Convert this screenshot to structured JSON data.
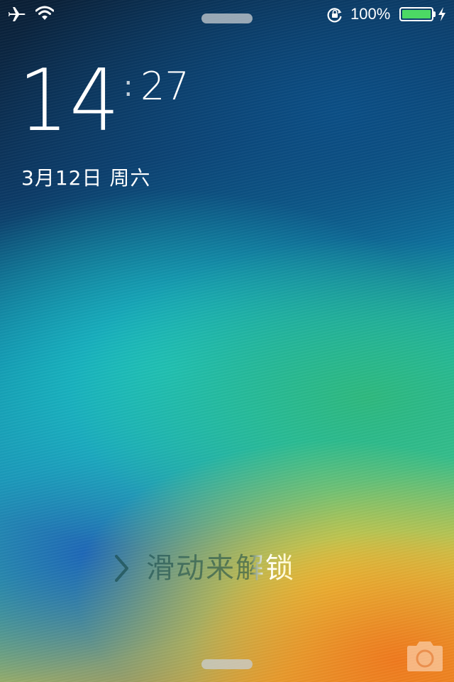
{
  "status_bar": {
    "battery_percent": "100%",
    "battery_level": 1.0,
    "icons": [
      "airplane-icon",
      "wifi-icon",
      "rotation-lock-icon",
      "battery-icon",
      "charging-icon"
    ],
    "battery_color": "#4cd964"
  },
  "lock_screen": {
    "hours": "14",
    "separator": ":",
    "minutes": "27",
    "date": "3月12日 周六",
    "slide_to_unlock": "滑动来解锁"
  },
  "bottom": {
    "icons": [
      "camera-icon"
    ]
  }
}
